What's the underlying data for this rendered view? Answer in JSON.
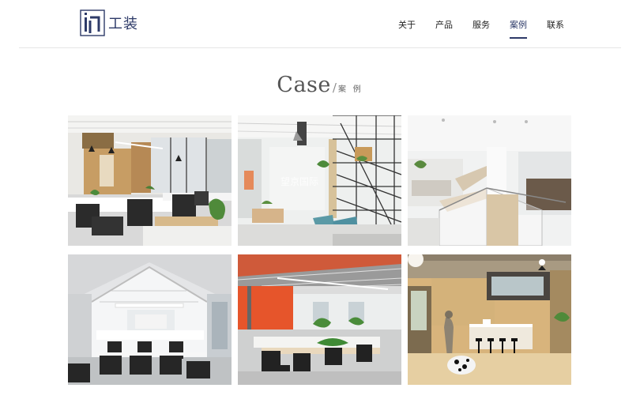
{
  "brand": {
    "logo_icon": "logo-mark-icon",
    "name": "工装"
  },
  "nav": {
    "items": [
      {
        "label": "关于"
      },
      {
        "label": "产品"
      },
      {
        "label": "服务"
      },
      {
        "label": "案例",
        "active": true
      },
      {
        "label": "联系"
      }
    ]
  },
  "section": {
    "title_en": "Case",
    "separator": "/",
    "title_cn": "案 例"
  },
  "cases": [
    {
      "image": "open-office-wood-shelves-photo"
    },
    {
      "image": "lounge-metal-staircase-photo",
      "overlay_text": "望京国际"
    },
    {
      "image": "white-loft-railing-photo"
    },
    {
      "image": "gabled-white-office-photo"
    },
    {
      "image": "orange-wall-workstations-photo"
    },
    {
      "image": "wooden-lobby-cafe-photo"
    }
  ],
  "colors": {
    "accent": "#2d3a68",
    "divider": "#e6e6e6",
    "text": "#222222"
  }
}
